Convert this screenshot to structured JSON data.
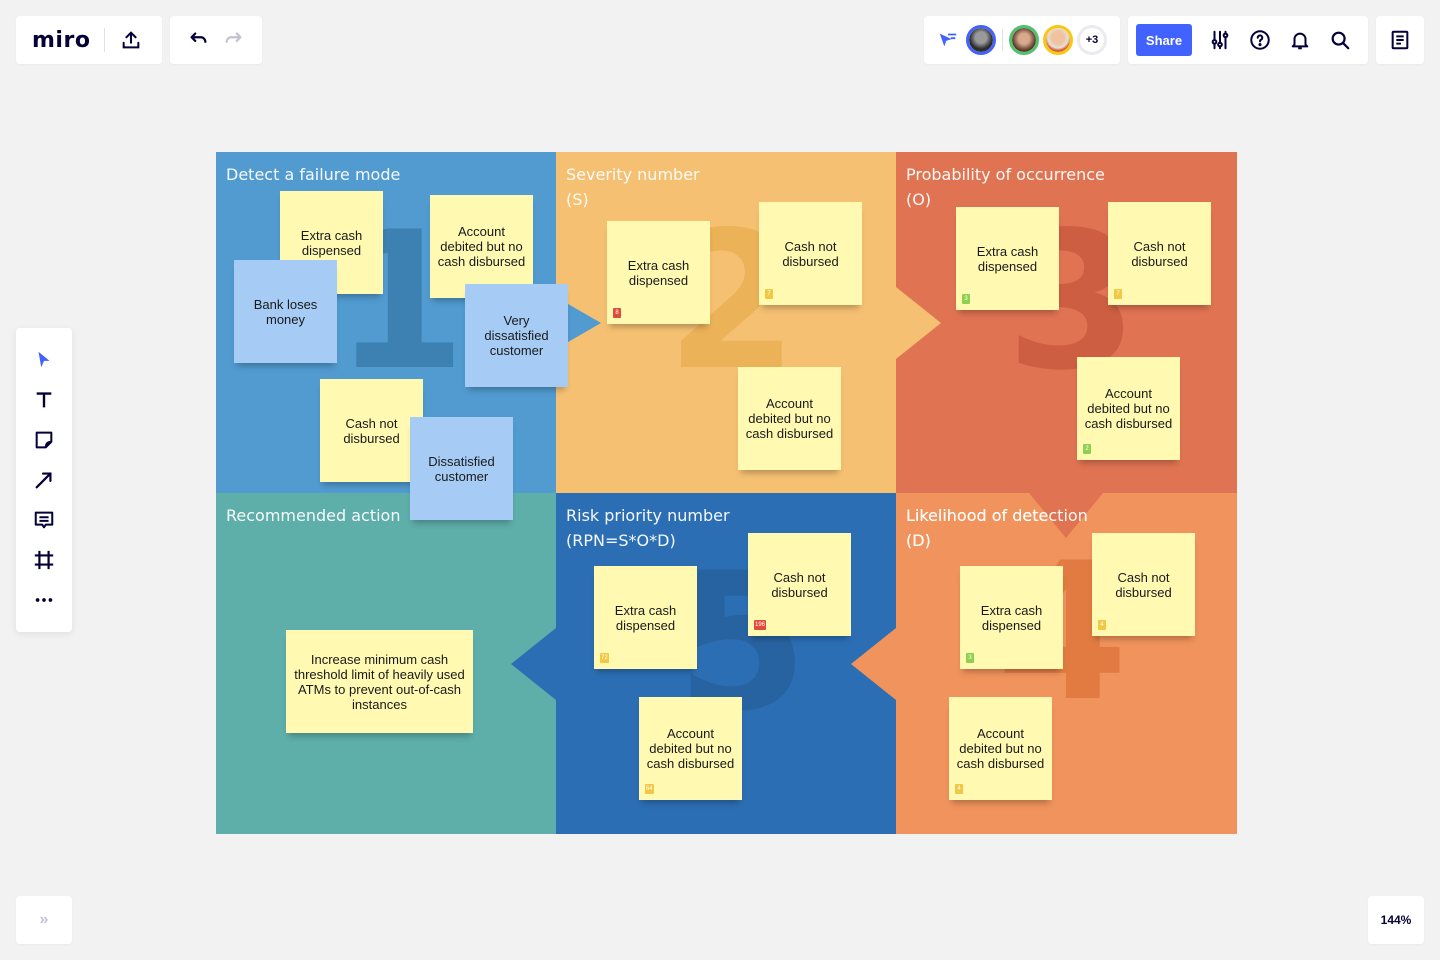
{
  "app": {
    "logo": "miro",
    "zoom_level": "144%",
    "share_label": "Share",
    "collaborators_more": "+3",
    "colors": {
      "accent": "#4262ff",
      "text": "#050038"
    }
  },
  "board": {
    "quadrants": [
      {
        "id": "detect",
        "title": "Detect a failure mode",
        "number": "1",
        "color": "#519bd0"
      },
      {
        "id": "severity",
        "title": "Severity number",
        "subtitle": "(S)",
        "number": "2",
        "color": "#f5c072"
      },
      {
        "id": "occurrence",
        "title": "Probability of occurrence",
        "subtitle": "(O)",
        "number": "3",
        "color": "#e07352"
      },
      {
        "id": "action",
        "title": "Recommended action",
        "color": "#5eaeaa"
      },
      {
        "id": "rpn",
        "title": "Risk priority number",
        "subtitle": "(RPN=S*O*D)",
        "number": "5",
        "color": "#2c6eb4"
      },
      {
        "id": "detection",
        "title": "Likelihood of detection",
        "subtitle": "(D)",
        "number": "4",
        "color": "#f0935c"
      }
    ],
    "stickies": {
      "detect": [
        {
          "text": "Extra cash dispensed",
          "color": "yellow"
        },
        {
          "text": "Bank loses money",
          "color": "blue"
        },
        {
          "text": "Account debited but no cash disbursed",
          "color": "yellow"
        },
        {
          "text": "Very dissatisfied customer",
          "color": "blue"
        },
        {
          "text": "Cash not disbursed",
          "color": "yellow"
        },
        {
          "text": "Dissatisfied customer",
          "color": "blue"
        }
      ],
      "severity": [
        {
          "text": "Extra cash dispensed",
          "badge": "8",
          "badge_color": "#e04a3a"
        },
        {
          "text": "Cash not disbursed",
          "badge": "7",
          "badge_color": "#f2c744"
        },
        {
          "text": "Account debited but no cash disbursed"
        }
      ],
      "occurrence": [
        {
          "text": "Extra cash dispensed",
          "badge": "3",
          "badge_color": "#8fd14f"
        },
        {
          "text": "Cash not disbursed",
          "badge": "7",
          "badge_color": "#f2c744"
        },
        {
          "text": "Account debited but no cash disbursed",
          "badge": "2",
          "badge_color": "#8fd14f"
        }
      ],
      "action": [
        {
          "text": "Increase minimum cash threshold limit of heavily used ATMs to prevent out-of-cash instances"
        }
      ],
      "rpn": [
        {
          "text": "Extra cash dispensed",
          "badge": "72",
          "badge_color": "#f2c744"
        },
        {
          "text": "Cash not disbursed",
          "badge": "196",
          "badge_color": "#e04a3a"
        },
        {
          "text": "Account debited but no cash disbursed",
          "badge": "64",
          "badge_color": "#f2c744"
        }
      ],
      "detection": [
        {
          "text": "Extra cash dispensed",
          "badge": "3",
          "badge_color": "#8fd14f"
        },
        {
          "text": "Cash not disbursed",
          "badge": "4",
          "badge_color": "#f2c744"
        },
        {
          "text": "Account debited but no cash disbursed",
          "badge": "4",
          "badge_color": "#f2c744"
        }
      ]
    }
  }
}
